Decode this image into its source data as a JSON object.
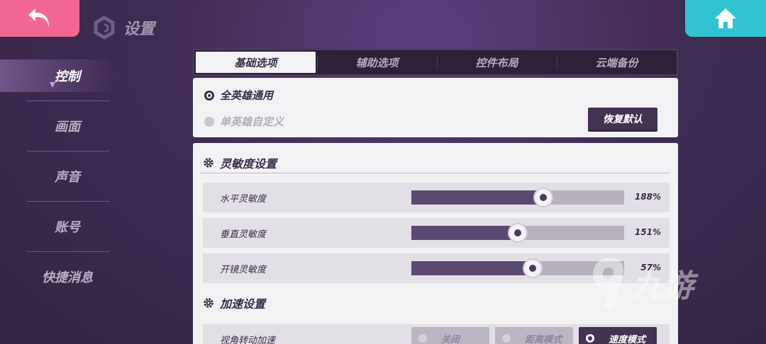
{
  "header": {
    "title": "设置",
    "back_icon": "back-arrow-icon",
    "home_icon": "home-icon",
    "colors": {
      "back": "#f2678f",
      "home": "#2fc4cf"
    }
  },
  "sidebar": {
    "items": [
      {
        "label": "控制",
        "active": true
      },
      {
        "label": "画面",
        "active": false
      },
      {
        "label": "声音",
        "active": false
      },
      {
        "label": "账号",
        "active": false
      },
      {
        "label": "快捷消息",
        "active": false
      }
    ]
  },
  "tabs": [
    {
      "label": "基础选项",
      "active": true
    },
    {
      "label": "辅助选项",
      "active": false
    },
    {
      "label": "控件布局",
      "active": false
    },
    {
      "label": "云端备份",
      "active": false
    }
  ],
  "mode": {
    "option_all": "全英雄通用",
    "option_custom": "单英雄自定义",
    "selected": "全英雄通用",
    "reset_label": "恢复默认"
  },
  "sensitivity": {
    "title": "灵敏度设置",
    "rows": [
      {
        "label": "水平灵敏度",
        "value": "188%",
        "level": 0.62
      },
      {
        "label": "垂直灵敏度",
        "value": "151%",
        "level": 0.5
      },
      {
        "label": "开镜灵敏度",
        "value": "57%",
        "level": 0.57
      }
    ]
  },
  "acceleration": {
    "title": "加速设置",
    "row_label": "视角转动加速",
    "options": [
      {
        "label": "关闭",
        "selected": false
      },
      {
        "label": "距离模式",
        "selected": false
      },
      {
        "label": "速度模式",
        "selected": true
      }
    ]
  },
  "watermark": {
    "text": "九游"
  }
}
